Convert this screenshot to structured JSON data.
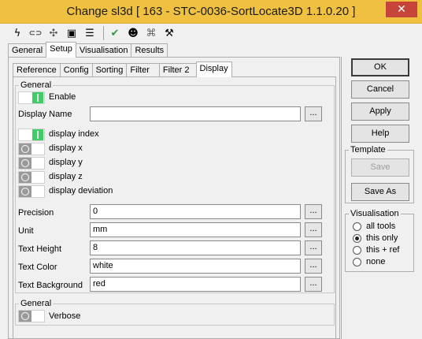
{
  "window": {
    "title": "Change sl3d [ 163 - STC-0036-SortLocate3D 1.1.0.20 ]",
    "close_glyph": "✕"
  },
  "toolbar": {
    "icons": [
      {
        "name": "lightning-icon",
        "glyph": "ϟ"
      },
      {
        "name": "link-icon",
        "glyph": "⊂⊃"
      },
      {
        "name": "puzzle-icon",
        "glyph": "✣"
      },
      {
        "name": "terminal-icon",
        "glyph": "▣"
      },
      {
        "name": "list-icon",
        "glyph": "☰"
      },
      {
        "name": "checkmark-icon",
        "glyph": "✔"
      },
      {
        "name": "robot-icon",
        "glyph": "☻"
      },
      {
        "name": "network-icon",
        "glyph": "⌘"
      },
      {
        "name": "wrench-icon",
        "glyph": "⚒"
      }
    ]
  },
  "main_tabs": [
    "General",
    "Setup",
    "Visualisation",
    "Results"
  ],
  "sub_tabs": [
    "Reference",
    "Config",
    "Sorting",
    "Filter",
    "Filter 2",
    "Display"
  ],
  "general_group": {
    "title": "General",
    "enable_label": "Enable",
    "display_name_label": "Display Name",
    "display_name_value": "",
    "options": [
      {
        "label": "display index",
        "on": true
      },
      {
        "label": "display x",
        "on": false
      },
      {
        "label": "display y",
        "on": false
      },
      {
        "label": "display z",
        "on": false
      },
      {
        "label": "display deviation",
        "on": false
      }
    ],
    "fields": [
      {
        "label": "Precision",
        "value": "0"
      },
      {
        "label": "Unit",
        "value": "mm"
      },
      {
        "label": "Text Height",
        "value": "8"
      },
      {
        "label": "Text Color",
        "value": "white"
      },
      {
        "label": "Text Background",
        "value": "red"
      }
    ],
    "browse_label": "..."
  },
  "general_group2": {
    "title": "General",
    "verbose_label": "Verbose"
  },
  "buttons": {
    "ok": "OK",
    "cancel": "Cancel",
    "apply": "Apply",
    "help": "Help"
  },
  "template_group": {
    "title": "Template",
    "save": "Save",
    "save_as": "Save As"
  },
  "visualisation_group": {
    "title": "Visualisation",
    "options": [
      "all tools",
      "this only",
      "this + ref",
      "none"
    ],
    "selected": "this only"
  }
}
